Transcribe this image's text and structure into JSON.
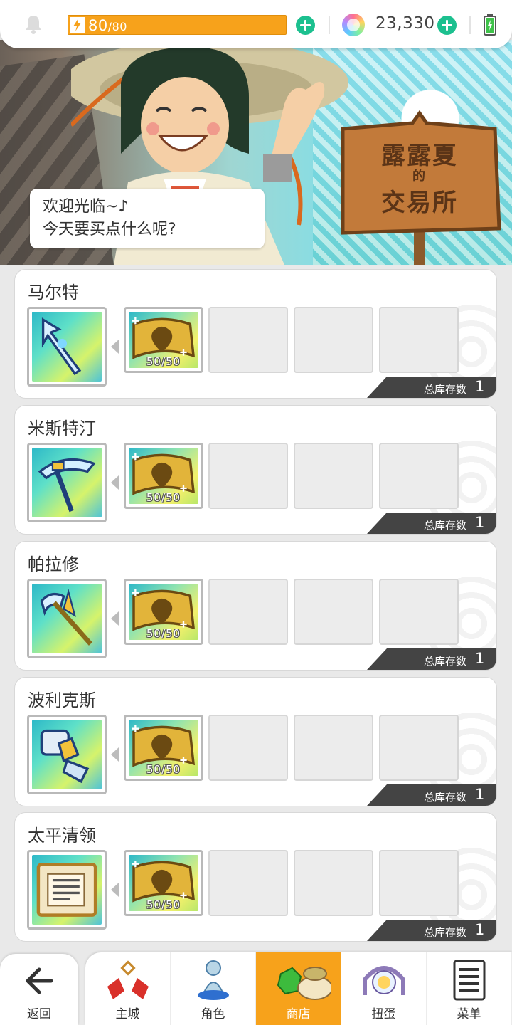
{
  "topbar": {
    "stamina_current": "80",
    "stamina_max": "/80",
    "gem_count": "23,330"
  },
  "banner": {
    "speech_line1": "欢迎光临~♪",
    "speech_line2": "今天要买点什么呢?",
    "sign_line1": "露露夏",
    "sign_line2": "的",
    "sign_line3": "交易所"
  },
  "shop": {
    "stock_label": "总库存数",
    "items": [
      {
        "name": "马尔特",
        "cost_count": "50/50",
        "stock": "1",
        "icon": "spear-icon"
      },
      {
        "name": "米斯特汀",
        "cost_count": "50/50",
        "stock": "1",
        "icon": "crossbow-icon"
      },
      {
        "name": "帕拉修",
        "cost_count": "50/50",
        "stock": "1",
        "icon": "axe-staff-icon"
      },
      {
        "name": "波利克斯",
        "cost_count": "50/50",
        "stock": "1",
        "icon": "gauntlet-icon"
      },
      {
        "name": "太平清领",
        "cost_count": "50/50",
        "stock": "1",
        "icon": "scroll-icon"
      }
    ]
  },
  "nav": {
    "back": "返回",
    "items": [
      {
        "label": "主城",
        "icon": "castle-icon"
      },
      {
        "label": "角色",
        "icon": "character-icon"
      },
      {
        "label": "商店",
        "icon": "shop-icon",
        "active": true
      },
      {
        "label": "扭蛋",
        "icon": "gacha-icon"
      },
      {
        "label": "菜单",
        "icon": "menu-list-icon"
      }
    ]
  },
  "colors": {
    "accent_orange": "#f7a21b",
    "plus_green": "#1cc08f",
    "stock_dark": "#444444"
  }
}
